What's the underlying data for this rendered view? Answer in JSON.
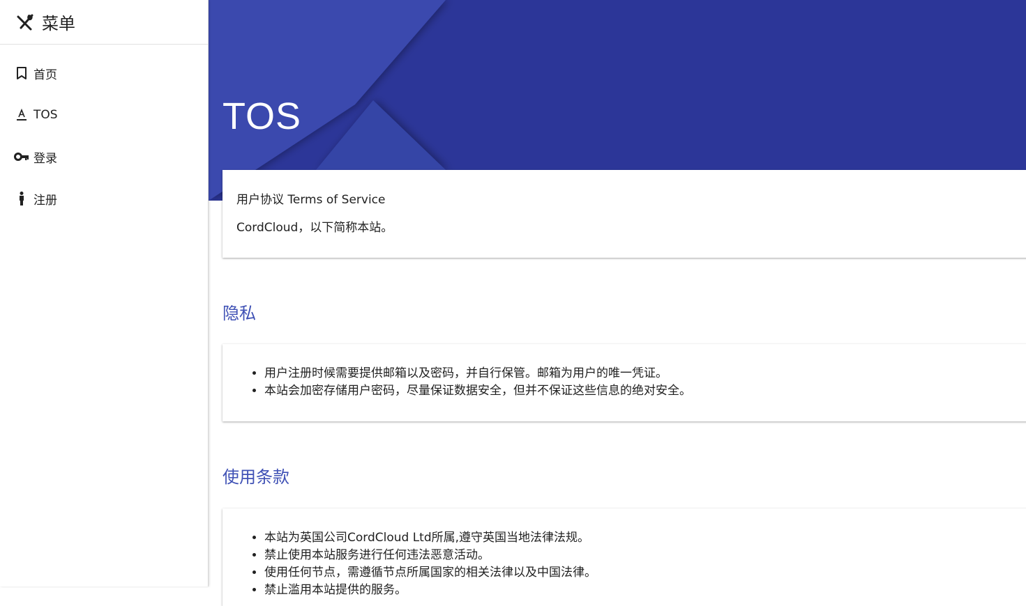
{
  "sidebar": {
    "title": "菜单",
    "items": [
      {
        "label": "首页",
        "icon": "bookmark-icon"
      },
      {
        "label": "TOS",
        "icon": "text-format-icon"
      },
      {
        "label": "登录",
        "icon": "key-icon"
      },
      {
        "label": "注册",
        "icon": "person-icon"
      }
    ]
  },
  "hero": {
    "title": "TOS"
  },
  "intro": {
    "line1": "用户协议 Terms of Service",
    "line2": "CordCloud，以下简称本站。"
  },
  "privacy": {
    "heading": "隐私",
    "items": [
      "用户注册时候需要提供邮箱以及密码，并自行保管。邮箱为用户的唯一凭证。",
      "本站会加密存储用户密码，尽量保证数据安全，但并不保证这些信息的绝对安全。"
    ]
  },
  "terms": {
    "heading": "使用条款",
    "items": [
      "本站为英国公司CordCloud Ltd所属,遵守英国当地法律法规。",
      "禁止使用本站服务进行任何违法恶意活动。",
      "使用任何节点，需遵循节点所属国家的相关法律以及中国法律。",
      "禁止滥用本站提供的服务。"
    ]
  },
  "colors": {
    "accent": "#3f51b5",
    "hero_dark": "#2c3698",
    "hero_light": "#3a4aae"
  }
}
